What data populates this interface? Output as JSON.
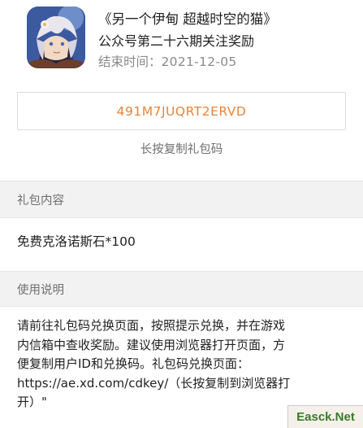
{
  "header": {
    "game_title": "《另一个伊甸 超越时空的猫》",
    "subtitle": "公众号第二十六期关注奖励",
    "end_time_label": "结束时间：",
    "end_time_value": "2021-12-05"
  },
  "gift": {
    "code": "491M7JUQRT2ERVD",
    "copy_hint": "长按复制礼包码"
  },
  "sections": {
    "content_title": "礼包内容",
    "content_value": "免费克洛诺斯石*100",
    "usage_title": "使用说明",
    "usage_lines": [
      "请前往礼包码兑换页面，按照提示兑换，并在游戏",
      "内信箱中查收奖励。建议使用浏览器打开页面，方",
      "便复制用户ID和兑换码。礼包码兑换页面：",
      "https://ae.xd.com/cdkey/（长按复制到浏览器打",
      "开）\""
    ]
  },
  "watermark": "Easck.Net",
  "colors": {
    "code_orange": "#e8843a",
    "section_bg": "#f2f2f2",
    "muted_text": "#8a8a8a"
  },
  "icons": {
    "app_icon": "game-app-icon"
  }
}
